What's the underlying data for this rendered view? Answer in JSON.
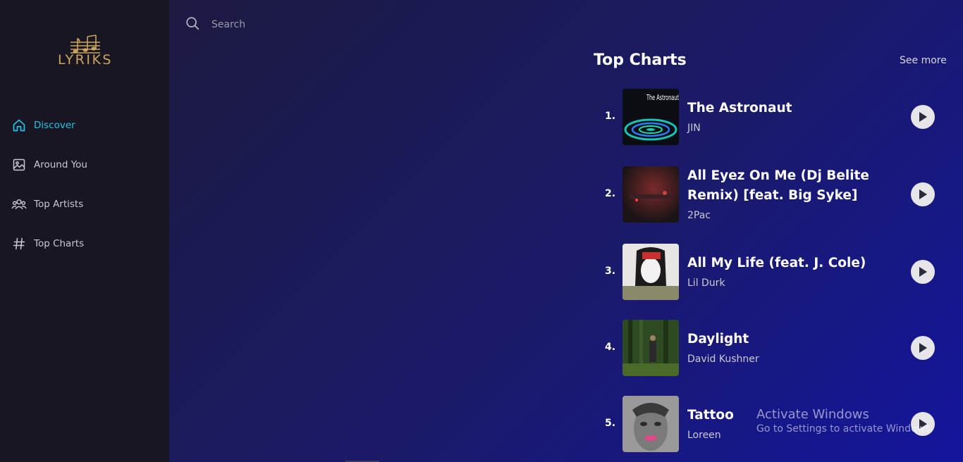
{
  "brand": {
    "name": "LYRIKS",
    "logo_icon": "music-notes-icon"
  },
  "sidebar": {
    "items": [
      {
        "label": "Discover",
        "icon": "home-icon",
        "active": true
      },
      {
        "label": "Around You",
        "icon": "image-icon",
        "active": false
      },
      {
        "label": "Top Artists",
        "icon": "users-icon",
        "active": false
      },
      {
        "label": "Top Charts",
        "icon": "hash-icon",
        "active": false
      }
    ]
  },
  "search": {
    "placeholder": "Search",
    "icon": "search-icon"
  },
  "top_charts": {
    "title": "Top Charts",
    "see_more": "See more",
    "songs": [
      {
        "rank": "1.",
        "title": "The Astronaut",
        "artist": "JIN"
      },
      {
        "rank": "2.",
        "title": "All Eyez On Me (Dj Belite Remix) [feat. Big Syke]",
        "artist": "2Pac"
      },
      {
        "rank": "3.",
        "title": "All My Life (feat. J. Cole)",
        "artist": "Lil Durk"
      },
      {
        "rank": "4.",
        "title": "Daylight",
        "artist": "David Kushner"
      },
      {
        "rank": "5.",
        "title": "Tattoo",
        "artist": "Loreen"
      }
    ],
    "cover_art_text": "The Astronaut"
  },
  "watermark": {
    "line1": "Activate Windows",
    "line2": "Go to Settings to activate Windows."
  },
  "colors": {
    "accent": "#22c4e8",
    "brand_gold": "#c9a45c",
    "sidebar_bg": "#191624"
  }
}
